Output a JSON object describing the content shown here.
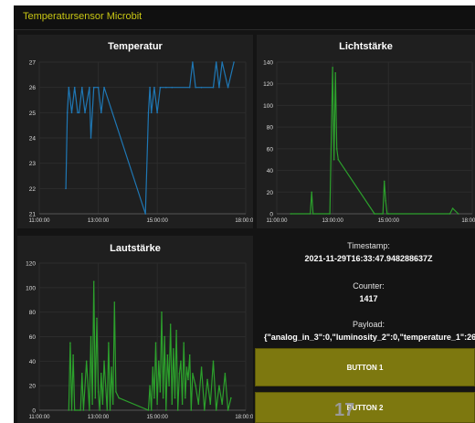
{
  "app": {
    "title": "Temperatursensor Microbit"
  },
  "charts": {
    "temperature": {
      "title": "Temperatur"
    },
    "light": {
      "title": "Lichtstärke"
    },
    "loudness": {
      "title": "Lautstärke"
    }
  },
  "info": {
    "timestamp_label": "Timestamp:",
    "timestamp_value": "2021-11-29T16:33:47.948288637Z",
    "counter_label": "Counter:",
    "counter_value": "1417",
    "payload_label": "Payload:",
    "payload_value": "{\"analog_in_3\":0,\"luminosity_2\":0,\"temperature_1\":26"
  },
  "buttons": {
    "button1": "BUTTON 1",
    "button2": "BUTTON 2"
  },
  "overlay": {
    "glyph": "17"
  },
  "colors": {
    "temperature": "#1f77b4",
    "light": "#2ca02c",
    "loudness": "#2ca02c",
    "button": "#7d780f",
    "title": "#c8c614"
  },
  "chart_data": [
    {
      "id": "temperature",
      "type": "line",
      "title": "Temperatur",
      "ylim": [
        21,
        27
      ],
      "yticks": [
        21,
        22,
        23,
        24,
        25,
        26,
        27
      ],
      "xlim": [
        11,
        18
      ],
      "xticks": [
        "11:00:00",
        "13:00:00",
        "15:00:00",
        "18:00:00"
      ],
      "xtick_values": [
        11,
        13,
        15,
        18
      ],
      "color": "#1f77b4",
      "x": [
        11.9,
        11.95,
        12.0,
        12.1,
        12.2,
        12.3,
        12.35,
        12.45,
        12.55,
        12.7,
        12.75,
        12.85,
        13.0,
        13.1,
        13.2,
        14.6,
        14.7,
        14.75,
        14.8,
        14.9,
        15.0,
        15.1,
        15.3,
        15.5,
        16.1,
        16.2,
        16.3,
        16.5,
        16.9,
        17.0,
        17.1,
        17.2,
        17.4,
        17.6
      ],
      "y": [
        22,
        25,
        26,
        25,
        26,
        25,
        25,
        26,
        25,
        26,
        24,
        26,
        26,
        25,
        26,
        21,
        25,
        26,
        25,
        26,
        25,
        26,
        26,
        26,
        26,
        27,
        26,
        26,
        26,
        27,
        26,
        27,
        26,
        27
      ]
    },
    {
      "id": "light",
      "type": "line",
      "title": "Lichtstärke",
      "ylim": [
        0,
        140
      ],
      "yticks": [
        0,
        20,
        40,
        60,
        80,
        100,
        120,
        140
      ],
      "xlim": [
        11,
        18
      ],
      "xticks": [
        "11:00:00",
        "13:00:00",
        "15:00:00",
        "18:00:00"
      ],
      "xtick_values": [
        11,
        13,
        15,
        18
      ],
      "color": "#2ca02c",
      "x": [
        11.5,
        12.2,
        12.25,
        12.3,
        12.9,
        13.0,
        13.05,
        13.1,
        13.15,
        13.2,
        14.5,
        14.8,
        14.85,
        14.9,
        14.95,
        15.0,
        17.2,
        17.3,
        17.5
      ],
      "y": [
        0,
        0,
        20,
        0,
        0,
        135,
        50,
        130,
        60,
        50,
        0,
        0,
        30,
        12,
        0,
        0,
        0,
        5,
        0
      ]
    },
    {
      "id": "loudness",
      "type": "line",
      "title": "Lautstärke",
      "ylim": [
        0,
        120
      ],
      "yticks": [
        0,
        20,
        40,
        60,
        80,
        100,
        120
      ],
      "xlim": [
        11,
        18
      ],
      "xticks": [
        "11:00:00",
        "13:00:00",
        "15:00:00",
        "18:00:00"
      ],
      "xtick_values": [
        11,
        13,
        15,
        18
      ],
      "color": "#2ca02c",
      "x": [
        12.0,
        12.05,
        12.1,
        12.15,
        12.2,
        12.4,
        12.45,
        12.5,
        12.6,
        12.7,
        12.75,
        12.8,
        12.85,
        12.9,
        12.95,
        13.0,
        13.05,
        13.1,
        13.15,
        13.2,
        13.3,
        13.35,
        13.4,
        13.45,
        13.5,
        13.55,
        13.6,
        13.7,
        14.7,
        14.75,
        14.8,
        14.85,
        14.9,
        14.95,
        15.0,
        15.05,
        15.1,
        15.15,
        15.2,
        15.25,
        15.3,
        15.35,
        15.4,
        15.45,
        15.5,
        15.55,
        15.6,
        15.65,
        15.7,
        15.75,
        15.8,
        15.85,
        15.9,
        15.95,
        16.0,
        16.05,
        16.1,
        16.15,
        16.2,
        16.3,
        16.4,
        16.5,
        16.6,
        16.7,
        16.8,
        16.9,
        17.0,
        17.1,
        17.2,
        17.3,
        17.4,
        17.5
      ],
      "y": [
        0,
        55,
        0,
        45,
        0,
        0,
        30,
        0,
        40,
        0,
        60,
        5,
        105,
        10,
        75,
        15,
        0,
        30,
        5,
        40,
        0,
        55,
        0,
        35,
        5,
        88,
        15,
        10,
        0,
        20,
        0,
        35,
        10,
        55,
        5,
        40,
        15,
        80,
        10,
        60,
        0,
        45,
        20,
        70,
        5,
        50,
        10,
        65,
        0,
        30,
        40,
        5,
        55,
        10,
        35,
        25,
        45,
        0,
        30,
        20,
        5,
        35,
        0,
        25,
        5,
        40,
        0,
        20,
        5,
        30,
        0,
        10
      ]
    }
  ]
}
